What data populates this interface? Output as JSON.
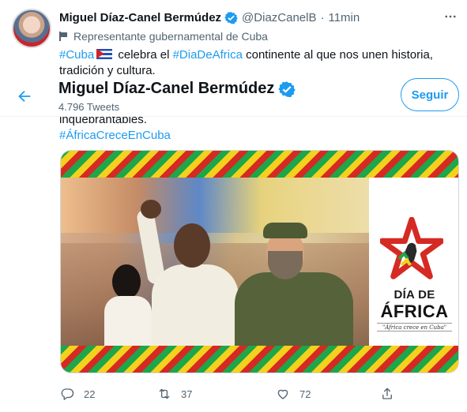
{
  "tweet": {
    "author_name": "Miguel Díaz-Canel Bermúdez",
    "handle": "@DiazCanelB",
    "separator": "·",
    "time": "11min",
    "label": "Representante gubernamental de Cuba",
    "text_parts": {
      "tag_cuba": "#Cuba",
      "t1": " celebra el ",
      "tag_dia": "#DiaDeAfrica",
      "t2": "  continente al que nos unen historia, tradición y cultura."
    },
    "text_cont": "inquebrantables.",
    "hashtag_cont": "#ÁfricaCreceEnCuba",
    "icons": {
      "more": "more-horizontal-icon",
      "label": "flag-icon",
      "verified": "verified-badge-icon"
    }
  },
  "profile_header": {
    "name": "Miguel Díaz-Canel Bermúdez",
    "tweet_count": "4.796 Tweets",
    "follow_label": "Seguir",
    "back_icon": "arrow-left-icon"
  },
  "media": {
    "logo_line1": "DÍA DE",
    "logo_line2": "ÁFRICA",
    "logo_tagline": "\"África crece en Cuba\"",
    "colors": {
      "green": "#1ea64a",
      "yellow": "#f3d11c",
      "red": "#d52a23"
    }
  },
  "actions": {
    "reply_count": "22",
    "retweet_count": "37",
    "like_count": "72",
    "icons": [
      "reply-icon",
      "retweet-icon",
      "like-icon",
      "share-icon"
    ]
  },
  "colors": {
    "link": "#1d9bf0",
    "secondary_text": "#536471",
    "primary_text": "#0f1419"
  }
}
